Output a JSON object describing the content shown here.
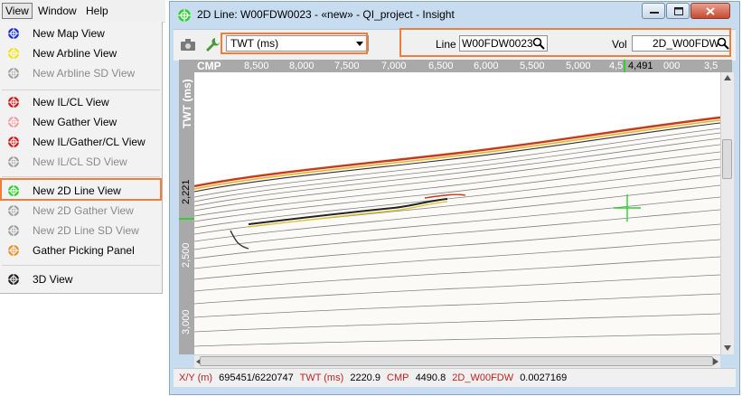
{
  "menubar": {
    "view": "View",
    "window": "Window",
    "help": "Help"
  },
  "menu": {
    "items": [
      {
        "label": "New Map View",
        "icon": "map-view-icon",
        "color": "#1a2fd0",
        "disabled": false
      },
      {
        "label": "New Arbline View",
        "icon": "arbline-view-icon",
        "color": "#f0e21a",
        "disabled": false
      },
      {
        "label": "New Arbline SD View",
        "icon": "arbline-sd-view-icon",
        "color": "#a0a0a0",
        "disabled": true
      },
      {
        "label": "New IL/CL View",
        "icon": "il-cl-view-icon",
        "color": "#d61a1a",
        "disabled": false
      },
      {
        "label": "New Gather View",
        "icon": "gather-view-icon",
        "color": "#f0a0a0",
        "disabled": false
      },
      {
        "label": "New IL/Gather/CL View",
        "icon": "il-gather-cl-view-icon",
        "color": "#d61a1a",
        "disabled": false
      },
      {
        "label": "New IL/CL SD View",
        "icon": "il-cl-sd-view-icon",
        "color": "#a0a0a0",
        "disabled": true
      },
      {
        "label": "New 2D Line View",
        "icon": "2d-line-view-icon",
        "color": "#2fd02f",
        "disabled": false
      },
      {
        "label": "New 2D Gather View",
        "icon": "2d-gather-view-icon",
        "color": "#a0a0a0",
        "disabled": true
      },
      {
        "label": "New 2D Line SD View",
        "icon": "2d-line-sd-view-icon",
        "color": "#a0a0a0",
        "disabled": true
      },
      {
        "label": "Gather Picking Panel",
        "icon": "gather-picking-icon",
        "color": "#e8902a",
        "disabled": false
      },
      {
        "label": "3D View",
        "icon": "3d-view-icon",
        "color": "#222222",
        "disabled": false
      }
    ]
  },
  "window": {
    "title": "2D Line: W00FDW0023 - «new» - QI_project - Insight",
    "accent": "#2fd02f"
  },
  "toolbar": {
    "camera_icon": "camera-icon",
    "wrench_icon": "wrench-icon",
    "twt_select": "TWT (ms)",
    "line_label": "Line",
    "line_value": "W00FDW0023",
    "vol_label": "Vol",
    "vol_value": "2D_W00FDW"
  },
  "axes": {
    "cmp_label": "CMP",
    "cmp_ticks": [
      "8,500",
      "8,000",
      "7,500",
      "7,000",
      "6,500",
      "6,000",
      "5,500",
      "5,000",
      "4,5",
      "4,491",
      "000",
      "3,5"
    ],
    "twt_label": "TWT (ms)",
    "twt_ticks": [
      "2,221",
      "2,500",
      "3,000"
    ]
  },
  "status": {
    "xy_label": "X/Y (m)",
    "xy_value": "695451/6220747",
    "twt_label": "TWT (ms)",
    "twt_value": "2220.9",
    "cmp_label": "CMP",
    "cmp_value": "4490.8",
    "vol_label": "2D_W00FDW",
    "vol_value": "0.0027169"
  },
  "highlight_color": "#ef7d3c"
}
